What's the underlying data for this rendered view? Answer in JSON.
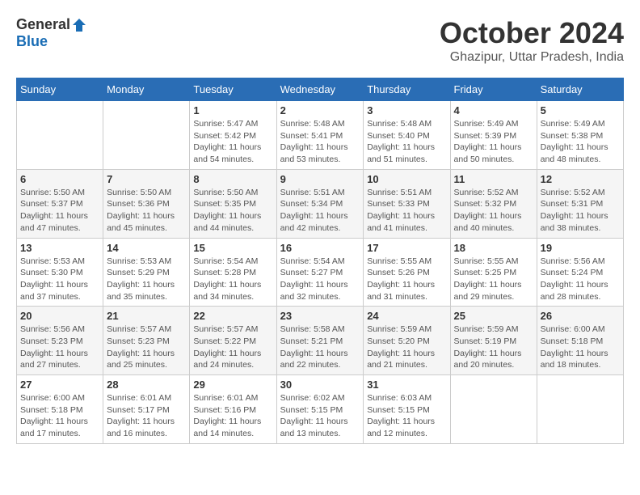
{
  "logo": {
    "general": "General",
    "blue": "Blue"
  },
  "title": {
    "month": "October 2024",
    "location": "Ghazipur, Uttar Pradesh, India"
  },
  "days_of_week": [
    "Sunday",
    "Monday",
    "Tuesday",
    "Wednesday",
    "Thursday",
    "Friday",
    "Saturday"
  ],
  "weeks": [
    [
      {
        "day": "",
        "info": ""
      },
      {
        "day": "",
        "info": ""
      },
      {
        "day": "1",
        "info": "Sunrise: 5:47 AM\nSunset: 5:42 PM\nDaylight: 11 hours and 54 minutes."
      },
      {
        "day": "2",
        "info": "Sunrise: 5:48 AM\nSunset: 5:41 PM\nDaylight: 11 hours and 53 minutes."
      },
      {
        "day": "3",
        "info": "Sunrise: 5:48 AM\nSunset: 5:40 PM\nDaylight: 11 hours and 51 minutes."
      },
      {
        "day": "4",
        "info": "Sunrise: 5:49 AM\nSunset: 5:39 PM\nDaylight: 11 hours and 50 minutes."
      },
      {
        "day": "5",
        "info": "Sunrise: 5:49 AM\nSunset: 5:38 PM\nDaylight: 11 hours and 48 minutes."
      }
    ],
    [
      {
        "day": "6",
        "info": "Sunrise: 5:50 AM\nSunset: 5:37 PM\nDaylight: 11 hours and 47 minutes."
      },
      {
        "day": "7",
        "info": "Sunrise: 5:50 AM\nSunset: 5:36 PM\nDaylight: 11 hours and 45 minutes."
      },
      {
        "day": "8",
        "info": "Sunrise: 5:50 AM\nSunset: 5:35 PM\nDaylight: 11 hours and 44 minutes."
      },
      {
        "day": "9",
        "info": "Sunrise: 5:51 AM\nSunset: 5:34 PM\nDaylight: 11 hours and 42 minutes."
      },
      {
        "day": "10",
        "info": "Sunrise: 5:51 AM\nSunset: 5:33 PM\nDaylight: 11 hours and 41 minutes."
      },
      {
        "day": "11",
        "info": "Sunrise: 5:52 AM\nSunset: 5:32 PM\nDaylight: 11 hours and 40 minutes."
      },
      {
        "day": "12",
        "info": "Sunrise: 5:52 AM\nSunset: 5:31 PM\nDaylight: 11 hours and 38 minutes."
      }
    ],
    [
      {
        "day": "13",
        "info": "Sunrise: 5:53 AM\nSunset: 5:30 PM\nDaylight: 11 hours and 37 minutes."
      },
      {
        "day": "14",
        "info": "Sunrise: 5:53 AM\nSunset: 5:29 PM\nDaylight: 11 hours and 35 minutes."
      },
      {
        "day": "15",
        "info": "Sunrise: 5:54 AM\nSunset: 5:28 PM\nDaylight: 11 hours and 34 minutes."
      },
      {
        "day": "16",
        "info": "Sunrise: 5:54 AM\nSunset: 5:27 PM\nDaylight: 11 hours and 32 minutes."
      },
      {
        "day": "17",
        "info": "Sunrise: 5:55 AM\nSunset: 5:26 PM\nDaylight: 11 hours and 31 minutes."
      },
      {
        "day": "18",
        "info": "Sunrise: 5:55 AM\nSunset: 5:25 PM\nDaylight: 11 hours and 29 minutes."
      },
      {
        "day": "19",
        "info": "Sunrise: 5:56 AM\nSunset: 5:24 PM\nDaylight: 11 hours and 28 minutes."
      }
    ],
    [
      {
        "day": "20",
        "info": "Sunrise: 5:56 AM\nSunset: 5:23 PM\nDaylight: 11 hours and 27 minutes."
      },
      {
        "day": "21",
        "info": "Sunrise: 5:57 AM\nSunset: 5:23 PM\nDaylight: 11 hours and 25 minutes."
      },
      {
        "day": "22",
        "info": "Sunrise: 5:57 AM\nSunset: 5:22 PM\nDaylight: 11 hours and 24 minutes."
      },
      {
        "day": "23",
        "info": "Sunrise: 5:58 AM\nSunset: 5:21 PM\nDaylight: 11 hours and 22 minutes."
      },
      {
        "day": "24",
        "info": "Sunrise: 5:59 AM\nSunset: 5:20 PM\nDaylight: 11 hours and 21 minutes."
      },
      {
        "day": "25",
        "info": "Sunrise: 5:59 AM\nSunset: 5:19 PM\nDaylight: 11 hours and 20 minutes."
      },
      {
        "day": "26",
        "info": "Sunrise: 6:00 AM\nSunset: 5:18 PM\nDaylight: 11 hours and 18 minutes."
      }
    ],
    [
      {
        "day": "27",
        "info": "Sunrise: 6:00 AM\nSunset: 5:18 PM\nDaylight: 11 hours and 17 minutes."
      },
      {
        "day": "28",
        "info": "Sunrise: 6:01 AM\nSunset: 5:17 PM\nDaylight: 11 hours and 16 minutes."
      },
      {
        "day": "29",
        "info": "Sunrise: 6:01 AM\nSunset: 5:16 PM\nDaylight: 11 hours and 14 minutes."
      },
      {
        "day": "30",
        "info": "Sunrise: 6:02 AM\nSunset: 5:15 PM\nDaylight: 11 hours and 13 minutes."
      },
      {
        "day": "31",
        "info": "Sunrise: 6:03 AM\nSunset: 5:15 PM\nDaylight: 11 hours and 12 minutes."
      },
      {
        "day": "",
        "info": ""
      },
      {
        "day": "",
        "info": ""
      }
    ]
  ]
}
